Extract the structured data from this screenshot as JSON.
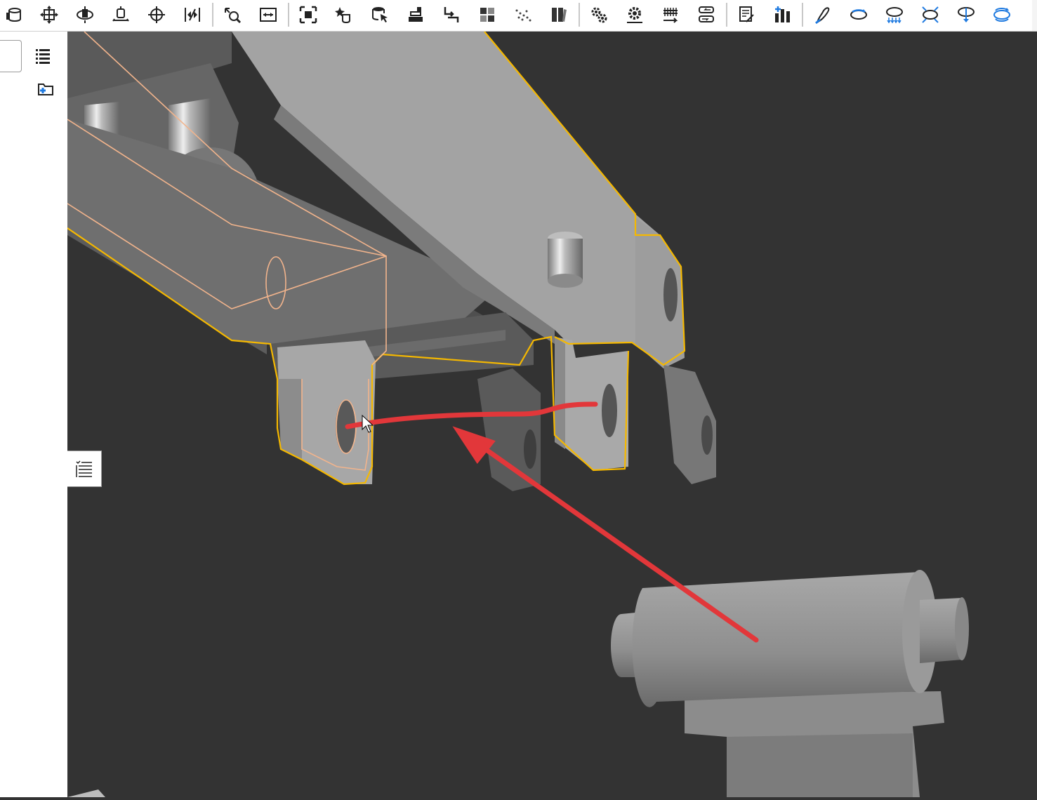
{
  "toolbar": {
    "groups": [
      [
        "layout-icon",
        "move-icon",
        "rotate-icon",
        "lift-icon",
        "pan-icon",
        "align-icon"
      ],
      [
        "fit-icon",
        "measure-icon"
      ],
      [
        "select-box-icon",
        "star-shape-icon",
        "database-cursor-icon",
        "stack-icon",
        "swap-icon",
        "grid-icon",
        "scatter-icon",
        "book-icon"
      ],
      [
        "gears-icon",
        "gear-icon",
        "rack-icon",
        "transfer-icon"
      ],
      [
        "sheet-link-icon",
        "add-bar-icon"
      ],
      [
        "curve-icon",
        "orbit-icon",
        "orbit-down-icon",
        "orbit-cross-icon",
        "orbit-drop-icon",
        "orbit-cycle-icon"
      ]
    ],
    "accent_color": "#1f7ae0"
  },
  "side_panel": {
    "items": [
      "list-icon",
      "add-folder-icon"
    ]
  },
  "viewport": {
    "background": "#333333",
    "selection_color": "#f5b800",
    "hidden_edge_color": "#f2b48c",
    "annotation_color": "#e2373a",
    "floating_button": "checklist-icon"
  }
}
